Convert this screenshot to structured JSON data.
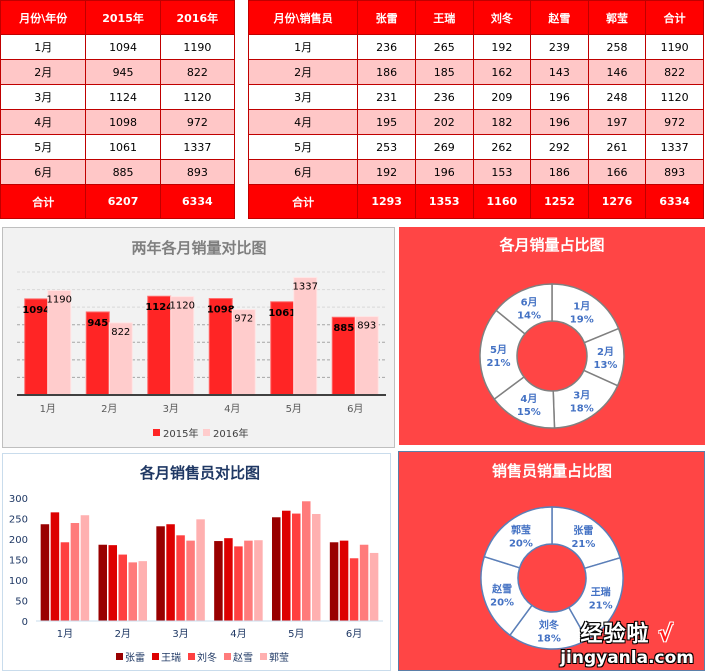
{
  "table_year": {
    "headers": [
      "月份\\年份",
      "2015年",
      "2016年"
    ],
    "rows": [
      [
        "1月",
        "1094",
        "1190"
      ],
      [
        "2月",
        "945",
        "822"
      ],
      [
        "3月",
        "1124",
        "1120"
      ],
      [
        "4月",
        "1098",
        "972"
      ],
      [
        "5月",
        "1061",
        "1337"
      ],
      [
        "6月",
        "885",
        "893"
      ]
    ],
    "total": [
      "合计",
      "6207",
      "6334"
    ]
  },
  "table_sales": {
    "headers": [
      "月份\\销售员",
      "张雷",
      "王瑞",
      "刘冬",
      "赵雪",
      "郭莹",
      "合计"
    ],
    "rows": [
      [
        "1月",
        "236",
        "265",
        "192",
        "239",
        "258",
        "1190"
      ],
      [
        "2月",
        "186",
        "185",
        "162",
        "143",
        "146",
        "822"
      ],
      [
        "3月",
        "231",
        "236",
        "209",
        "196",
        "248",
        "1120"
      ],
      [
        "4月",
        "195",
        "202",
        "182",
        "196",
        "197",
        "972"
      ],
      [
        "5月",
        "253",
        "269",
        "262",
        "292",
        "261",
        "1337"
      ],
      [
        "6月",
        "192",
        "196",
        "153",
        "186",
        "166",
        "893"
      ]
    ],
    "total": [
      "合计",
      "1293",
      "1353",
      "1160",
      "1252",
      "1276",
      "6334"
    ]
  },
  "colors": {
    "header_red": "#ff0000",
    "row_pink": "#ffc7c7",
    "panel_red": "#ff4545",
    "label_blue": "#4472c4"
  },
  "watermark": {
    "line1": "经验啦",
    "check": "√",
    "line2": "jingyanla.com"
  },
  "chart_data": [
    {
      "type": "bar",
      "title": "两年各月销量对比图",
      "categories": [
        "1月",
        "2月",
        "3月",
        "4月",
        "5月",
        "6月"
      ],
      "series": [
        {
          "name": "2015年",
          "values": [
            1094,
            945,
            1124,
            1098,
            1061,
            885
          ],
          "color": "#ff2525"
        },
        {
          "name": "2016年",
          "values": [
            1190,
            822,
            1120,
            972,
            1337,
            893
          ],
          "color": "#ffcccc"
        }
      ],
      "ylim": [
        0,
        1400
      ],
      "ystep": 200,
      "grid": true,
      "show_y_ticks": false,
      "data_labels": true,
      "legend": "bottom",
      "xlabel": "",
      "ylabel": ""
    },
    {
      "type": "pie",
      "variant": "doughnut",
      "title": "各月销量占比图",
      "labels": [
        "1月",
        "2月",
        "3月",
        "4月",
        "5月",
        "6月"
      ],
      "values": [
        1190,
        822,
        1120,
        972,
        1337,
        893
      ],
      "percent_labels": [
        "19%",
        "13%",
        "18%",
        "15%",
        "21%",
        "14%"
      ]
    },
    {
      "type": "bar",
      "title": "各月销售员对比图",
      "categories": [
        "1月",
        "2月",
        "3月",
        "4月",
        "5月",
        "6月"
      ],
      "series": [
        {
          "name": "张雷",
          "values": [
            236,
            186,
            231,
            195,
            253,
            192
          ],
          "color": "#990000"
        },
        {
          "name": "王瑞",
          "values": [
            265,
            185,
            236,
            202,
            269,
            196
          ],
          "color": "#dd0000"
        },
        {
          "name": "刘冬",
          "values": [
            192,
            162,
            209,
            182,
            262,
            153
          ],
          "color": "#ff4040"
        },
        {
          "name": "赵雪",
          "values": [
            239,
            143,
            196,
            196,
            292,
            186
          ],
          "color": "#ff7b7b"
        },
        {
          "name": "郭莹",
          "values": [
            258,
            146,
            248,
            197,
            261,
            166
          ],
          "color": "#ffb0b0"
        }
      ],
      "ylim": [
        0,
        300
      ],
      "ystep": 50,
      "yticks": [
        "0",
        "50",
        "100",
        "150",
        "200",
        "250",
        "300"
      ],
      "grid": false,
      "legend": "bottom",
      "xlabel": "",
      "ylabel": ""
    },
    {
      "type": "pie",
      "variant": "doughnut",
      "title": "销售员销量占比图",
      "labels": [
        "张雷",
        "王瑞",
        "刘冬",
        "赵雪",
        "郭莹"
      ],
      "values": [
        1293,
        1353,
        1160,
        1252,
        1276
      ],
      "percent_labels": [
        "21%",
        "21%",
        "18%",
        "20%",
        "20%"
      ]
    }
  ]
}
